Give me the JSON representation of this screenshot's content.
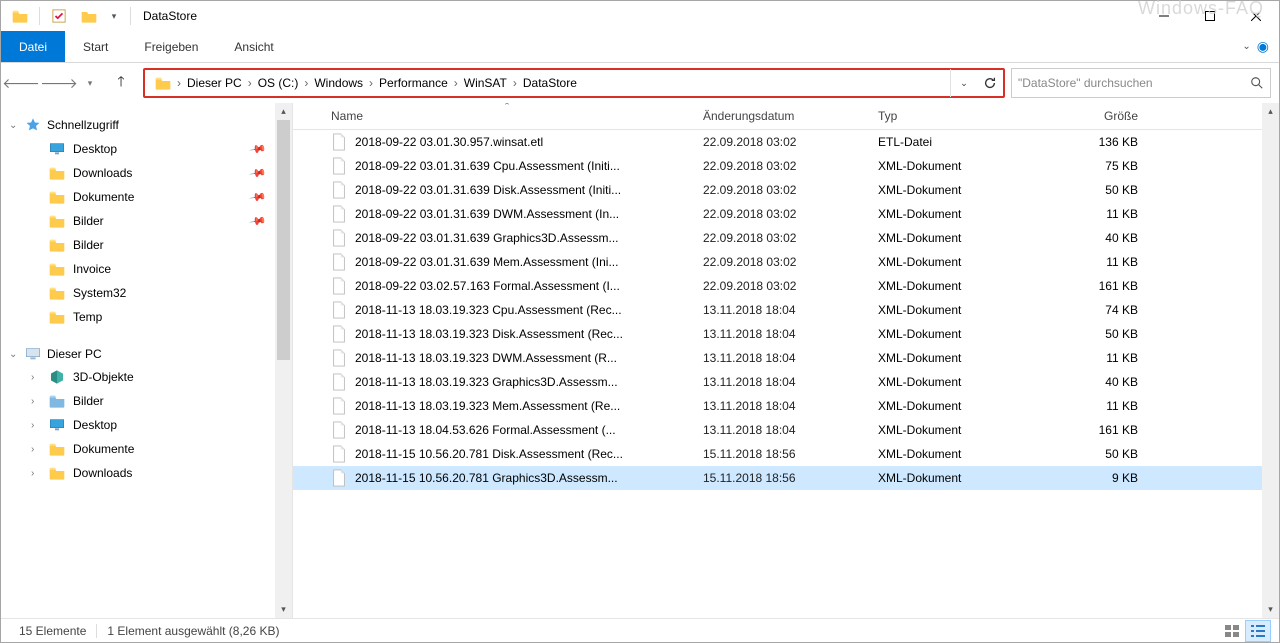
{
  "title": "DataStore",
  "watermark": "Windows-FAQ",
  "ribbon": {
    "file": "Datei",
    "tabs": [
      "Start",
      "Freigeben",
      "Ansicht"
    ]
  },
  "nav": {
    "back_enabled": false,
    "forward_enabled": false,
    "up_enabled": true
  },
  "address": {
    "crumbs": [
      "Dieser PC",
      "OS (C:)",
      "Windows",
      "Performance",
      "WinSAT",
      "DataStore"
    ]
  },
  "search": {
    "placeholder": "\"DataStore\" durchsuchen"
  },
  "tree": {
    "quick_access": {
      "label": "Schnellzugriff",
      "items": [
        {
          "label": "Desktop",
          "pinned": true,
          "icon": "desktop"
        },
        {
          "label": "Downloads",
          "pinned": true,
          "icon": "folder"
        },
        {
          "label": "Dokumente",
          "pinned": true,
          "icon": "folder"
        },
        {
          "label": "Bilder",
          "pinned": true,
          "icon": "folder"
        },
        {
          "label": "Bilder",
          "pinned": false,
          "icon": "folder"
        },
        {
          "label": "Invoice",
          "pinned": false,
          "icon": "folder"
        },
        {
          "label": "System32",
          "pinned": false,
          "icon": "folder"
        },
        {
          "label": "Temp",
          "pinned": false,
          "icon": "folder"
        }
      ]
    },
    "this_pc": {
      "label": "Dieser PC",
      "items": [
        {
          "label": "3D-Objekte",
          "icon": "3d"
        },
        {
          "label": "Bilder",
          "icon": "pictures"
        },
        {
          "label": "Desktop",
          "icon": "desktop"
        },
        {
          "label": "Dokumente",
          "icon": "documents"
        },
        {
          "label": "Downloads",
          "icon": "downloads"
        }
      ]
    }
  },
  "columns": {
    "name": "Name",
    "date": "Änderungsdatum",
    "type": "Typ",
    "size": "Größe"
  },
  "files": [
    {
      "name": "2018-09-22 03.01.30.957.winsat.etl",
      "date": "22.09.2018 03:02",
      "type": "ETL-Datei",
      "size": "136 KB",
      "selected": false
    },
    {
      "name": "2018-09-22 03.01.31.639 Cpu.Assessment (Initi...",
      "date": "22.09.2018 03:02",
      "type": "XML-Dokument",
      "size": "75 KB",
      "selected": false
    },
    {
      "name": "2018-09-22 03.01.31.639 Disk.Assessment (Initi...",
      "date": "22.09.2018 03:02",
      "type": "XML-Dokument",
      "size": "50 KB",
      "selected": false
    },
    {
      "name": "2018-09-22 03.01.31.639 DWM.Assessment (In...",
      "date": "22.09.2018 03:02",
      "type": "XML-Dokument",
      "size": "11 KB",
      "selected": false
    },
    {
      "name": "2018-09-22 03.01.31.639 Graphics3D.Assessm...",
      "date": "22.09.2018 03:02",
      "type": "XML-Dokument",
      "size": "40 KB",
      "selected": false
    },
    {
      "name": "2018-09-22 03.01.31.639 Mem.Assessment (Ini...",
      "date": "22.09.2018 03:02",
      "type": "XML-Dokument",
      "size": "11 KB",
      "selected": false
    },
    {
      "name": "2018-09-22 03.02.57.163 Formal.Assessment (I...",
      "date": "22.09.2018 03:02",
      "type": "XML-Dokument",
      "size": "161 KB",
      "selected": false
    },
    {
      "name": "2018-11-13 18.03.19.323 Cpu.Assessment (Rec...",
      "date": "13.11.2018 18:04",
      "type": "XML-Dokument",
      "size": "74 KB",
      "selected": false
    },
    {
      "name": "2018-11-13 18.03.19.323 Disk.Assessment (Rec...",
      "date": "13.11.2018 18:04",
      "type": "XML-Dokument",
      "size": "50 KB",
      "selected": false
    },
    {
      "name": "2018-11-13 18.03.19.323 DWM.Assessment (R...",
      "date": "13.11.2018 18:04",
      "type": "XML-Dokument",
      "size": "11 KB",
      "selected": false
    },
    {
      "name": "2018-11-13 18.03.19.323 Graphics3D.Assessm...",
      "date": "13.11.2018 18:04",
      "type": "XML-Dokument",
      "size": "40 KB",
      "selected": false
    },
    {
      "name": "2018-11-13 18.03.19.323 Mem.Assessment (Re...",
      "date": "13.11.2018 18:04",
      "type": "XML-Dokument",
      "size": "11 KB",
      "selected": false
    },
    {
      "name": "2018-11-13 18.04.53.626 Formal.Assessment (...",
      "date": "13.11.2018 18:04",
      "type": "XML-Dokument",
      "size": "161 KB",
      "selected": false
    },
    {
      "name": "2018-11-15 10.56.20.781 Disk.Assessment (Rec...",
      "date": "15.11.2018 18:56",
      "type": "XML-Dokument",
      "size": "50 KB",
      "selected": false
    },
    {
      "name": "2018-11-15 10.56.20.781 Graphics3D.Assessm...",
      "date": "15.11.2018 18:56",
      "type": "XML-Dokument",
      "size": "9 KB",
      "selected": true
    }
  ],
  "status": {
    "count": "15 Elemente",
    "selection": "1 Element ausgewählt (8,26 KB)"
  }
}
